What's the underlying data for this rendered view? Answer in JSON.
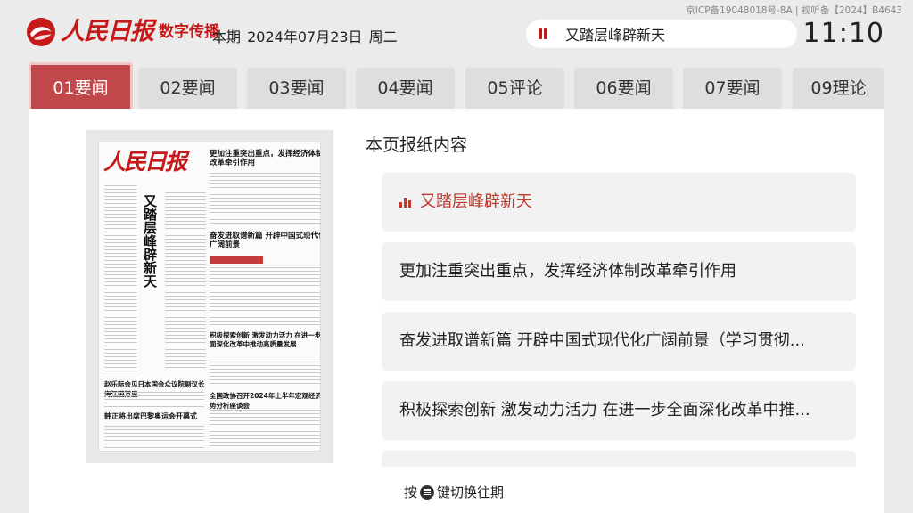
{
  "header": {
    "brand_script": "人民日报",
    "brand_sub": "数字传播",
    "issue_label": "本期",
    "issue_date": "2024年07月23日",
    "weekday": "周二",
    "icp": "京ICP备19048018号-8A | 视听备【2024】B4643",
    "now_playing": "又踏层峰辟新天",
    "clock": "11:10"
  },
  "tabs": [
    {
      "label": "01要闻",
      "active": true
    },
    {
      "label": "02要闻",
      "active": false
    },
    {
      "label": "03要闻",
      "active": false
    },
    {
      "label": "04要闻",
      "active": false
    },
    {
      "label": "05评论",
      "active": false
    },
    {
      "label": "06要闻",
      "active": false
    },
    {
      "label": "07要闻",
      "active": false
    },
    {
      "label": "09理论",
      "active": false
    }
  ],
  "paper_preview": {
    "logo": "人民日报",
    "headline_top": "更加注重突出重点，发挥经济体制改革牵引作用",
    "vertical_headline": "又踏层峰辟新天",
    "headline_mid": "奋发进取谱新篇 开辟中国式现代化广阔前景",
    "headline_low_left": "赵乐际会见日本国会众议院副议长海江田万里",
    "headline_low_right": "全国政协召开2024年上半年宏观经济形势分析座谈会",
    "headline_low_left2": "韩正将出席巴黎奥运会开幕式",
    "headline_right_block": "积极探索创新 激发动力活力 在进一步全面深化改革中推动高质量发展"
  },
  "main": {
    "section_title": "本页报纸内容",
    "articles": [
      "又踏层峰辟新天",
      "更加注重突出重点，发挥经济体制改革牵引作用",
      "奋发进取谱新篇 开辟中国式现代化广阔前景（学习贯彻...",
      "积极探索创新 激发动力活力 在进一步全面深化改革中推..."
    ],
    "hint_before": "按",
    "hint_after": "键切换往期"
  },
  "colors": {
    "brand_red": "#c61a1a",
    "tab_active": "#c0484a",
    "article_active": "#c0392b"
  }
}
